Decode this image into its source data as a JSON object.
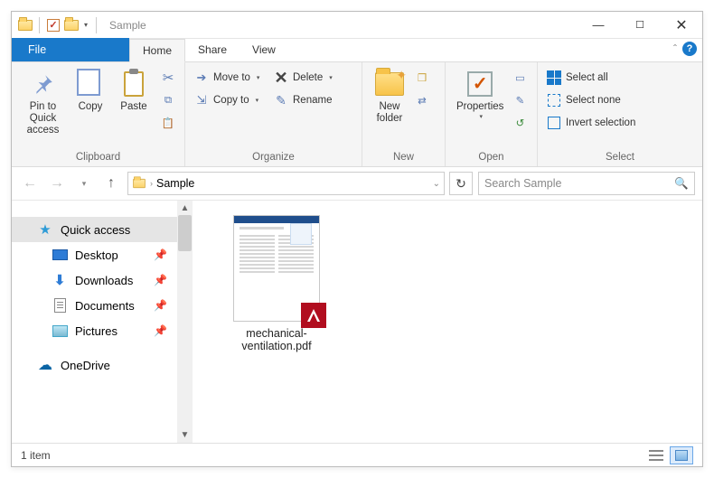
{
  "window": {
    "title": "Sample"
  },
  "tabs": {
    "file": "File",
    "home": "Home",
    "share": "Share",
    "view": "View"
  },
  "ribbon": {
    "clipboard": {
      "label": "Clipboard",
      "pin": "Pin to Quick\naccess",
      "copy": "Copy",
      "paste": "Paste"
    },
    "organize": {
      "label": "Organize",
      "moveto": "Move to",
      "copyto": "Copy to",
      "delete": "Delete",
      "rename": "Rename"
    },
    "new": {
      "label": "New",
      "newfolder": "New\nfolder"
    },
    "open": {
      "label": "Open",
      "properties": "Properties"
    },
    "select": {
      "label": "Select",
      "selectall": "Select all",
      "selectnone": "Select none",
      "invert": "Invert selection"
    }
  },
  "address": {
    "segments": [
      "Sample"
    ]
  },
  "search": {
    "placeholder": "Search Sample"
  },
  "tree": {
    "quick": "Quick access",
    "desktop": "Desktop",
    "downloads": "Downloads",
    "documents": "Documents",
    "pictures": "Pictures",
    "onedrive": "OneDrive"
  },
  "files": [
    {
      "name": "mechanical-ventilation.pdf",
      "type": "pdf"
    }
  ],
  "status": {
    "count": "1 item"
  }
}
